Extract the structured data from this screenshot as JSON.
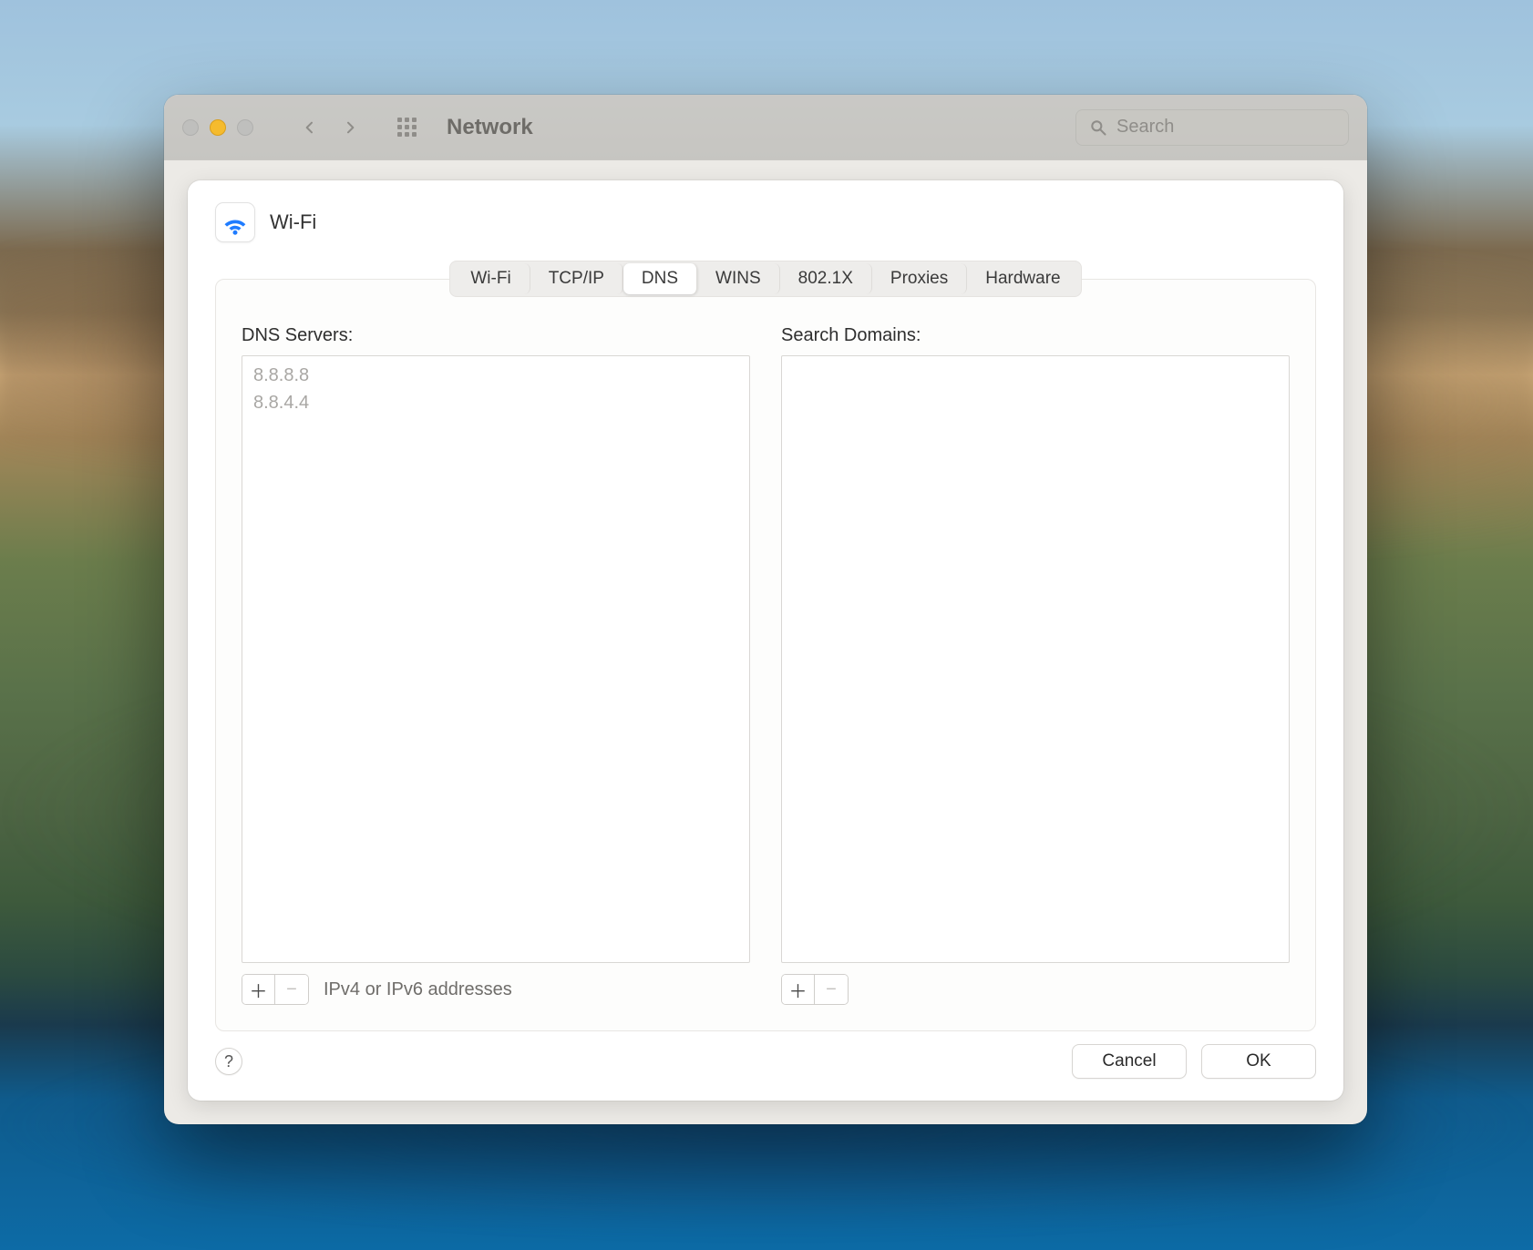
{
  "window": {
    "title": "Network",
    "search_placeholder": "Search"
  },
  "sheet": {
    "interface_name": "Wi-Fi",
    "tabs": [
      "Wi-Fi",
      "TCP/IP",
      "DNS",
      "WINS",
      "802.1X",
      "Proxies",
      "Hardware"
    ],
    "active_tab_index": 2,
    "dns": {
      "servers_label": "DNS Servers:",
      "domains_label": "Search Domains:",
      "servers": [
        "8.8.8.8",
        "8.8.4.4"
      ],
      "domains": [],
      "hint": "IPv4 or IPv6 addresses"
    },
    "buttons": {
      "help": "?",
      "cancel": "Cancel",
      "ok": "OK"
    }
  }
}
